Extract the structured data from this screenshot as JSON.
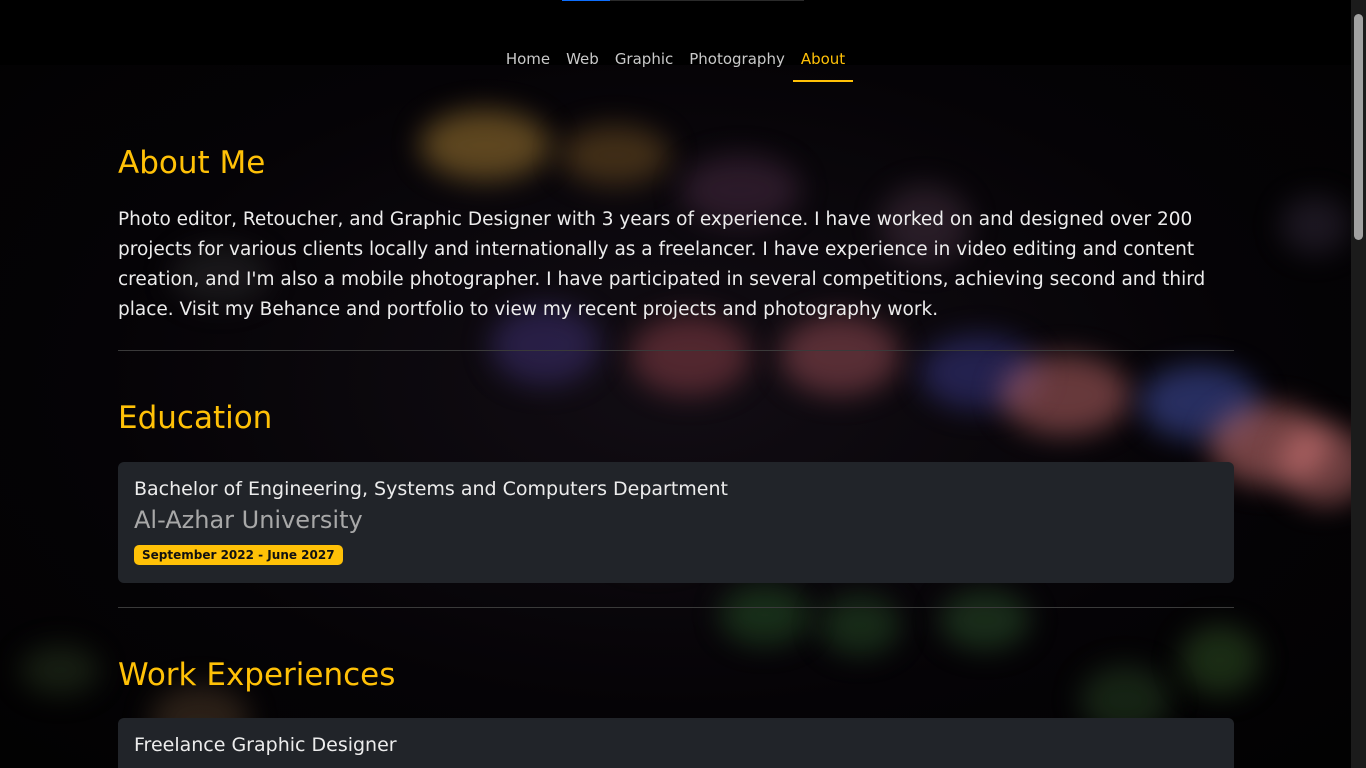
{
  "nav": {
    "items": [
      "Home",
      "Web",
      "Graphic",
      "Photography",
      "About"
    ],
    "active": "About"
  },
  "about": {
    "title": "About Me",
    "text": "Photo editor, Retoucher, and Graphic Designer with 3 years of experience. I have worked on and designed over 200 projects for various clients locally and internationally as a freelancer. I have experience in video editing and content creation, and I'm also a mobile photographer. I have participated in several competitions, achieving second and third place. Visit my Behance and portfolio to view my recent projects and photography work."
  },
  "education": {
    "title": "Education",
    "degree": "Bachelor of Engineering, Systems and Computers Department",
    "school": "Al-Azhar University",
    "period": "September 2022 - June 2027"
  },
  "work": {
    "title": "Work Experiences",
    "first_role": "Freelance Graphic Designer"
  },
  "colors": {
    "accent": "#ffc107",
    "card_bg": "#212429",
    "progress": "#0d6efd"
  },
  "page_progress": 0.2
}
